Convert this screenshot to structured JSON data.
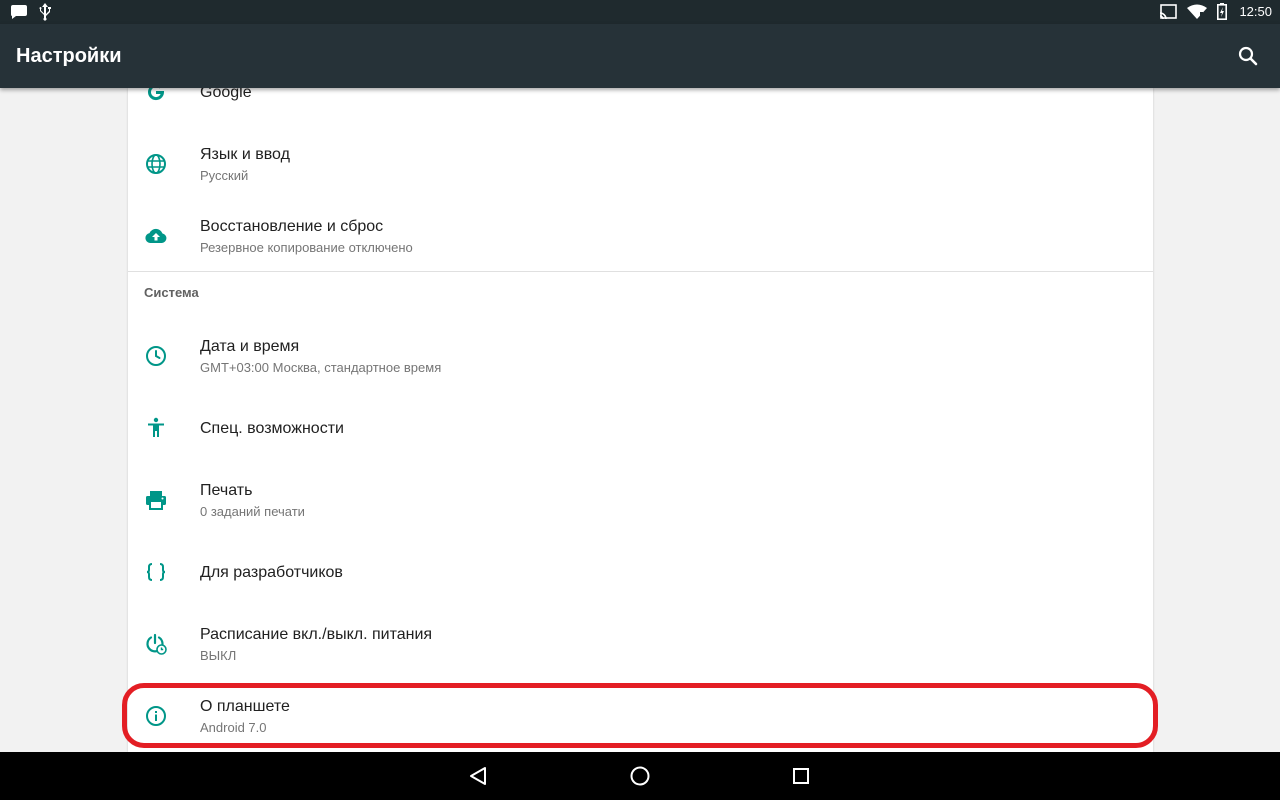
{
  "status_bar": {
    "time": "12:50",
    "left_icons": [
      "chat-bubble-icon",
      "usb-icon"
    ],
    "right_icons": [
      "cast-icon",
      "wifi-icon",
      "battery-charging-icon"
    ]
  },
  "app_bar": {
    "title": "Настройки",
    "action_icon": "search-icon"
  },
  "settings": {
    "items_top": [
      {
        "id": "google",
        "icon": "google-g-icon",
        "title": "Google",
        "summary": ""
      },
      {
        "id": "language",
        "icon": "globe-icon",
        "title": "Язык и ввод",
        "summary": "Русский"
      },
      {
        "id": "backup",
        "icon": "cloud-upload-icon",
        "title": "Восстановление и сброс",
        "summary": "Резервное копирование отключено"
      }
    ],
    "system_section_label": "Система",
    "items_system": [
      {
        "id": "datetime",
        "icon": "clock-icon",
        "title": "Дата и время",
        "summary": "GMT+03:00 Москва, стандартное время"
      },
      {
        "id": "accessibility",
        "icon": "accessibility-icon",
        "title": "Спец. возможности",
        "summary": ""
      },
      {
        "id": "printing",
        "icon": "printer-icon",
        "title": "Печать",
        "summary": "0 заданий печати"
      },
      {
        "id": "developer",
        "icon": "braces-icon",
        "title": "Для разработчиков",
        "summary": ""
      },
      {
        "id": "power-schedule",
        "icon": "power-clock-icon",
        "title": "Расписание вкл./выкл. питания",
        "summary": "ВЫКЛ"
      },
      {
        "id": "about",
        "icon": "info-icon",
        "title": "О планшете",
        "summary": "Android 7.0"
      }
    ]
  },
  "highlight_target": "about",
  "nav_bar": {
    "icons": [
      "back-triangle-icon",
      "home-circle-icon",
      "recents-square-icon"
    ]
  },
  "colors": {
    "status_bar_bg": "#1f2a2e",
    "app_bar_bg": "#263238",
    "accent": "#009688",
    "highlight_border": "#e31e24"
  }
}
